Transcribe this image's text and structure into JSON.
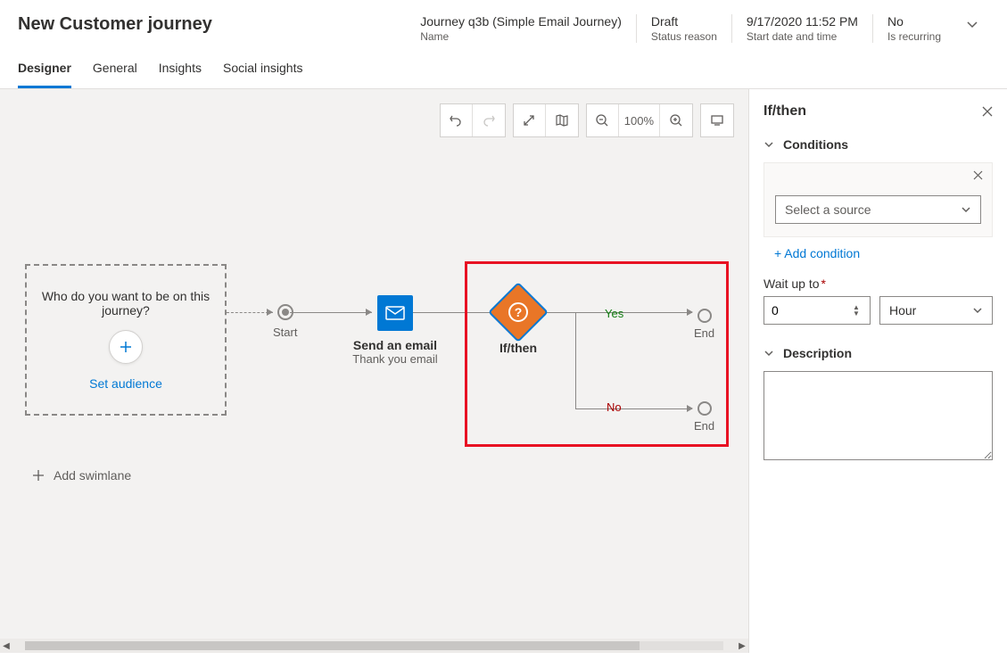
{
  "page_title": "New Customer journey",
  "header_fields": [
    {
      "value": "Journey q3b (Simple Email Journey)",
      "label": "Name"
    },
    {
      "value": "Draft",
      "label": "Status reason"
    },
    {
      "value": "9/17/2020 11:52 PM",
      "label": "Start date and time"
    },
    {
      "value": "No",
      "label": "Is recurring"
    }
  ],
  "tabs": [
    "Designer",
    "General",
    "Insights",
    "Social insights"
  ],
  "active_tab": "Designer",
  "toolbar": {
    "zoom": "100%"
  },
  "canvas": {
    "audience": {
      "question": "Who do you want to be on this journey?",
      "action": "Set audience"
    },
    "start_label": "Start",
    "email": {
      "title": "Send an email",
      "subtitle": "Thank you email"
    },
    "ifthen": {
      "title": "If/then"
    },
    "branch_yes": "Yes",
    "branch_no": "No",
    "end_label": "End",
    "add_swimlane": "Add swimlane"
  },
  "panel": {
    "title": "If/then",
    "sections": {
      "conditions": "Conditions",
      "description": "Description"
    },
    "source_placeholder": "Select a source",
    "add_condition": "+ Add condition",
    "wait_label": "Wait up to",
    "wait_value": "0",
    "wait_unit": "Hour",
    "description_value": ""
  }
}
